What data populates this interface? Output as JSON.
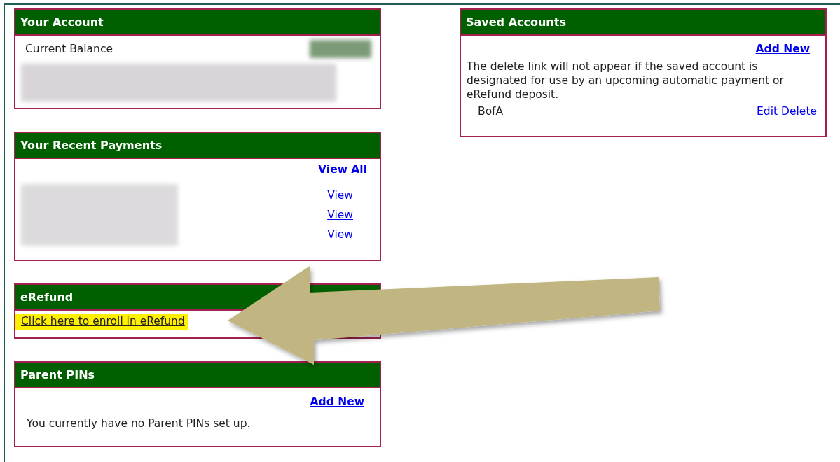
{
  "your_account": {
    "title": "Your Account",
    "balance_label": "Current Balance"
  },
  "recent_payments": {
    "title": "Your Recent Payments",
    "view_all": "View All",
    "view_links": [
      "View",
      "View",
      "View"
    ]
  },
  "erefund": {
    "title": "eRefund",
    "enroll_link": "Click here to enroll in eRefund",
    "highlighted": true
  },
  "parent_pins": {
    "title": "Parent PINs",
    "add_new": "Add New",
    "message": "You currently have no Parent PINs set up."
  },
  "saved_accounts": {
    "title": "Saved Accounts",
    "add_new": "Add New",
    "note": "The delete link will not appear if the saved account is designated for use by an upcoming automatic payment or eRefund deposit.",
    "accounts": [
      {
        "name": "BofA",
        "actions": [
          "Edit",
          "Delete"
        ]
      }
    ]
  },
  "annotation": {
    "kind": "arrow"
  }
}
